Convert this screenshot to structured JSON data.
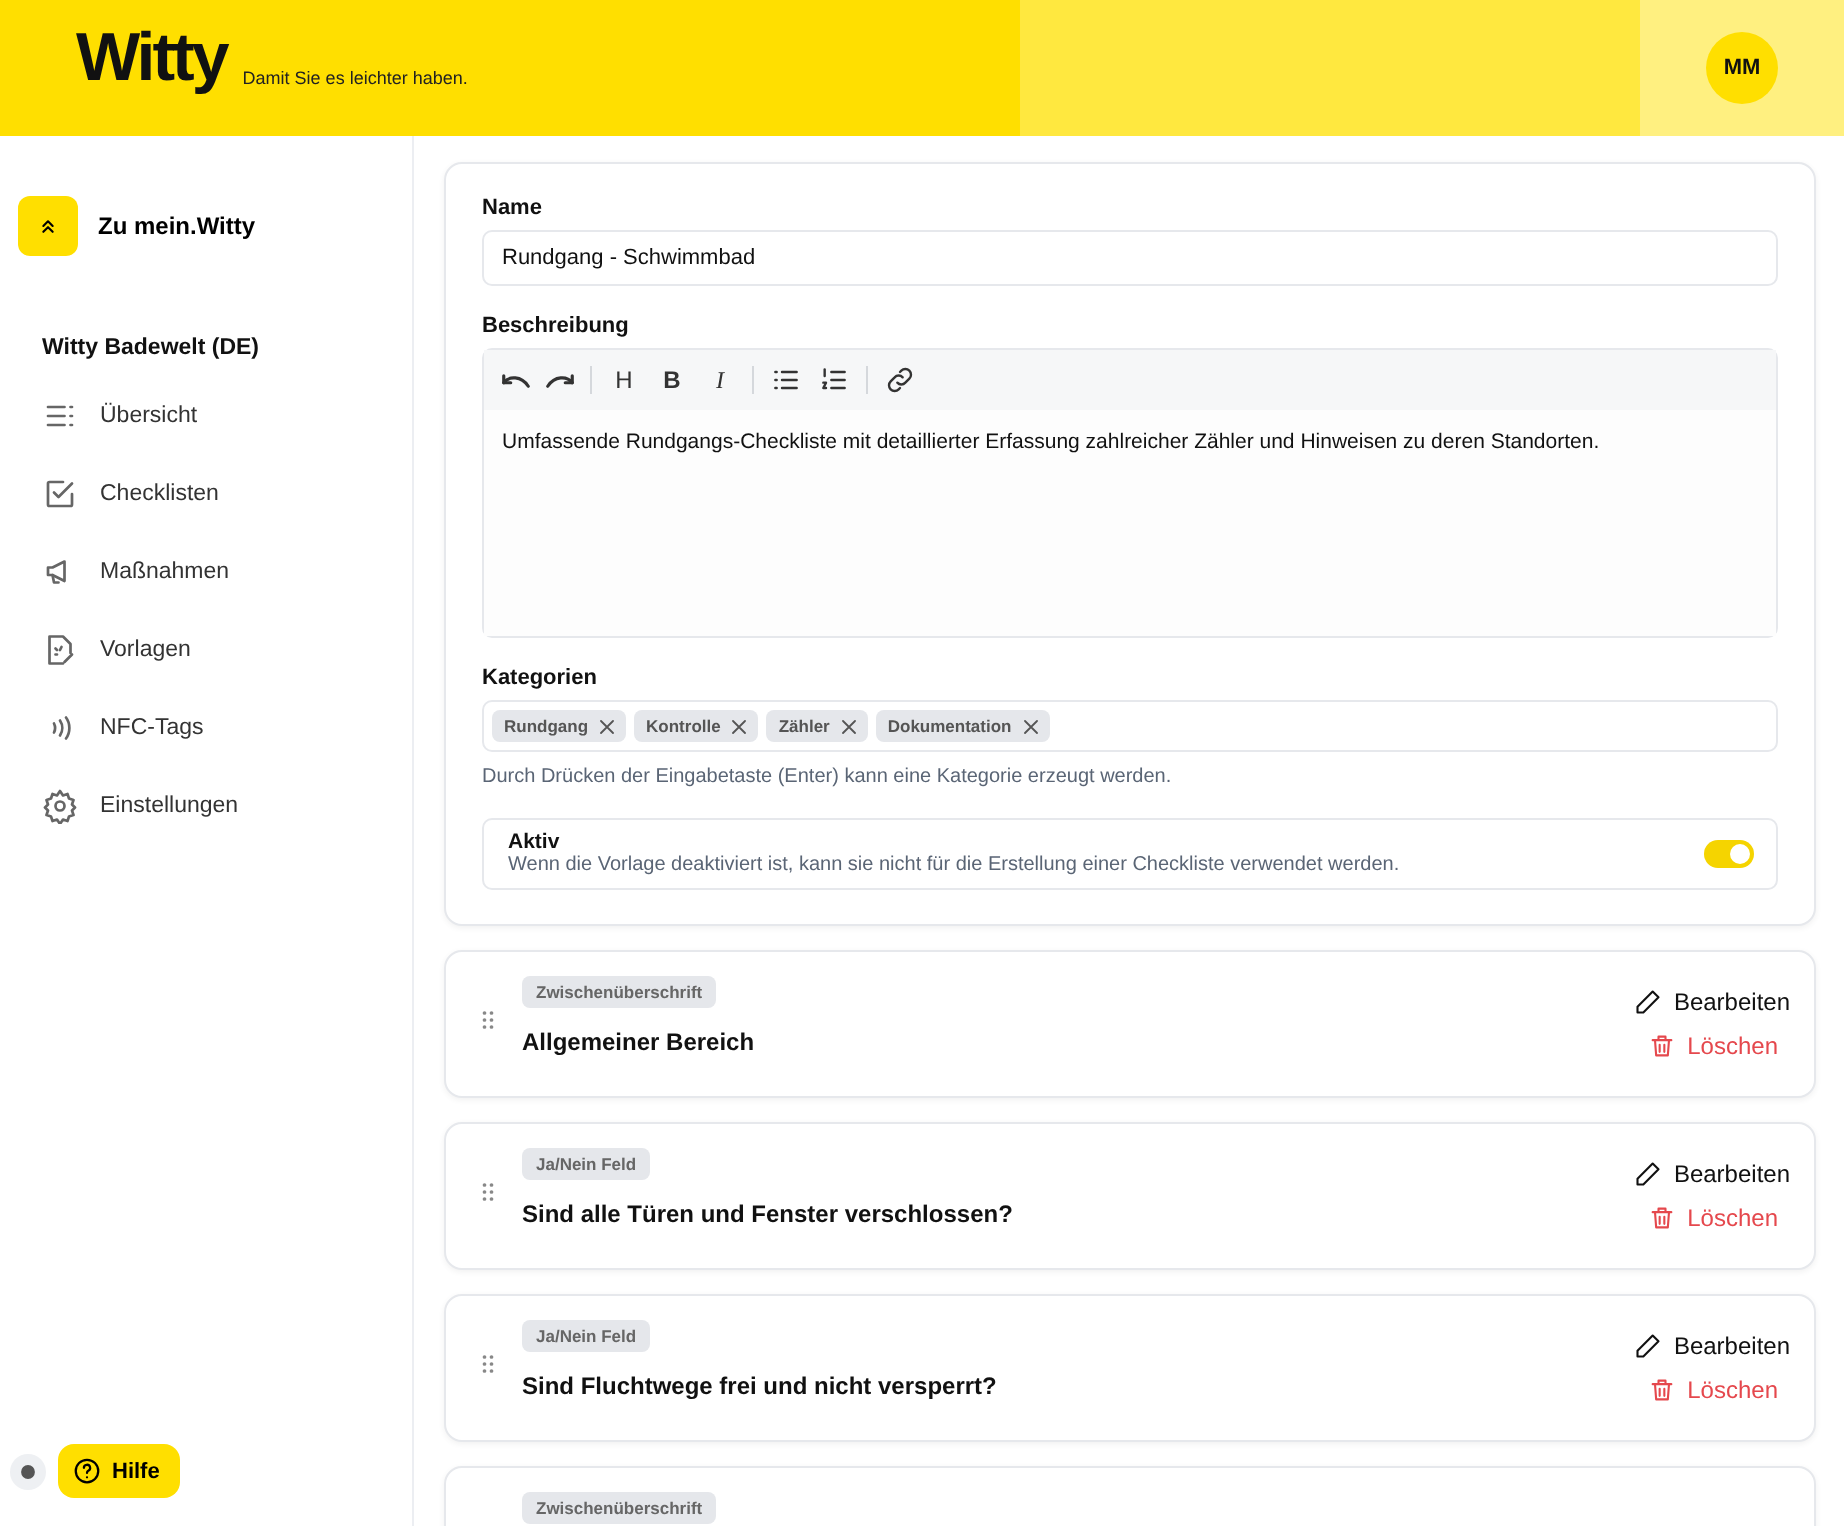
{
  "header": {
    "logo": "Witty",
    "tagline": "Damit Sie es leichter haben.",
    "avatar": "MM"
  },
  "sidebar": {
    "back": "Zu mein.Witty",
    "org": "Witty Badewelt (DE)",
    "items": [
      {
        "kind": "overview",
        "label": "Übersicht"
      },
      {
        "kind": "checklists",
        "label": "Checklisten"
      },
      {
        "kind": "measures",
        "label": "Maßnahmen"
      },
      {
        "kind": "templates",
        "label": "Vorlagen"
      },
      {
        "kind": "nfc",
        "label": "NFC-Tags"
      },
      {
        "kind": "settings",
        "label": "Einstellungen"
      }
    ],
    "help": "Hilfe"
  },
  "form": {
    "name_label": "Name",
    "name_value": "Rundgang - Schwimmbad",
    "description_label": "Beschreibung",
    "toolbar": [
      {
        "kind": "undo"
      },
      {
        "kind": "redo"
      },
      {
        "kind": "sep"
      },
      {
        "kind": "heading",
        "label": "H"
      },
      {
        "kind": "bold",
        "label": "B"
      },
      {
        "kind": "italic",
        "label": "I"
      },
      {
        "kind": "sep"
      },
      {
        "kind": "bullets"
      },
      {
        "kind": "numbers"
      },
      {
        "kind": "sep"
      },
      {
        "kind": "link"
      }
    ],
    "description": "Umfassende Rundgangs-Checkliste mit detaillierter Erfassung zahlreicher Zähler und Hinweisen zu deren Standorten.",
    "categories_label": "Kategorien",
    "categories": [
      "Rundgang",
      "Kontrolle",
      "Zähler",
      "Dokumentation"
    ],
    "categories_hint": "Durch Drücken der Eingabetaste (Enter) kann eine Kategorie erzeugt werden.",
    "active_label": "Aktiv",
    "active_hint": "Wenn die Vorlage deaktiviert ist, kann sie nicht für die Erstellung einer Checkliste verwendet werden.",
    "active_on": true
  },
  "items": [
    {
      "type": "Zwischenüberschrift",
      "title": "Allgemeiner Bereich",
      "edit": "Bearbeiten",
      "delete": "Löschen"
    },
    {
      "type": "Ja/Nein Feld",
      "title": "Sind alle Türen und Fenster verschlossen?",
      "edit": "Bearbeiten",
      "delete": "Löschen"
    },
    {
      "type": "Ja/Nein Feld",
      "title": "Sind Fluchtwege frei und nicht versperrt?",
      "edit": "Bearbeiten",
      "delete": "Löschen"
    },
    {
      "type": "Zwischenüberschrift"
    }
  ]
}
